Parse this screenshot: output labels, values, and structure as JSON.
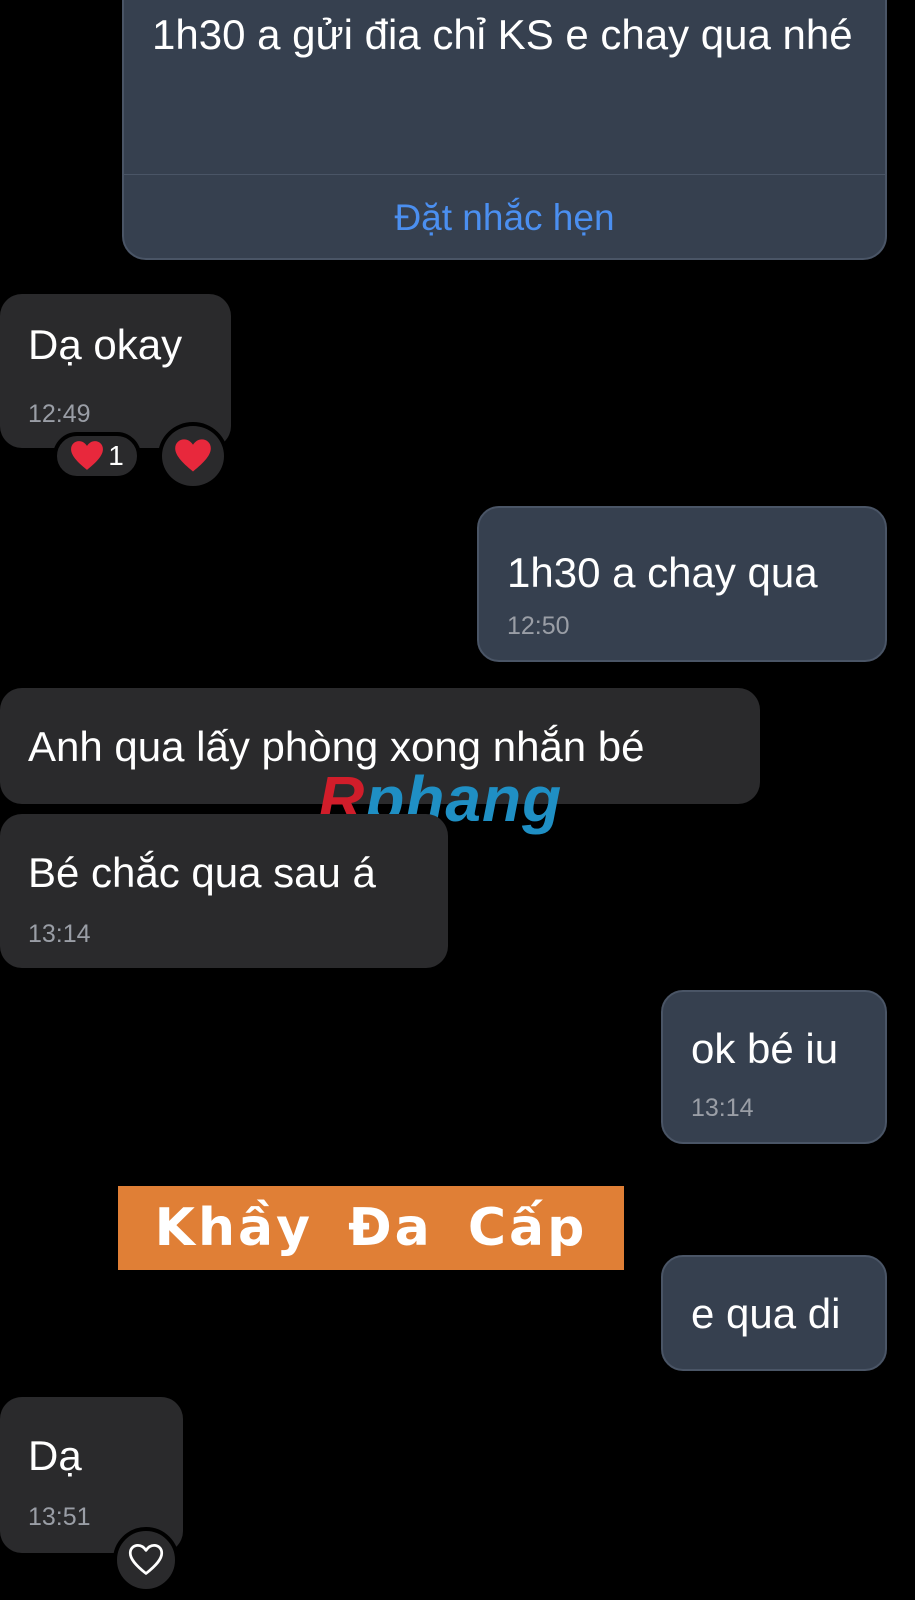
{
  "messages": [
    {
      "text": "1h30 a gửi đia chỉ KS e chay qua nhé",
      "action": "Đặt nhắc hẹn"
    },
    {
      "text": "Dạ okay",
      "time": "12:49",
      "reaction_count": "1"
    },
    {
      "text": "1h30 a chay qua",
      "time": "12:50"
    },
    {
      "text": "Anh qua lấy phòng xong nhắn bé"
    },
    {
      "text": "Bé chắc qua sau á",
      "time": "13:14"
    },
    {
      "text": "ok bé iu",
      "time": "13:14"
    },
    {
      "text": "e qua di"
    },
    {
      "text": "Dạ",
      "time": "13:51"
    }
  ],
  "overlays": {
    "watermark_first": "R",
    "watermark_rest": "phang",
    "banner": "Khầy Đa Cấp"
  },
  "colors": {
    "received_bubble": "#2a2a2c",
    "sent_bubble": "#36404f",
    "link": "#4b8ff0",
    "banner": "#e07f36",
    "heart": "#e8283c"
  },
  "icons": [
    "heart-icon",
    "heart-outline-icon"
  ]
}
